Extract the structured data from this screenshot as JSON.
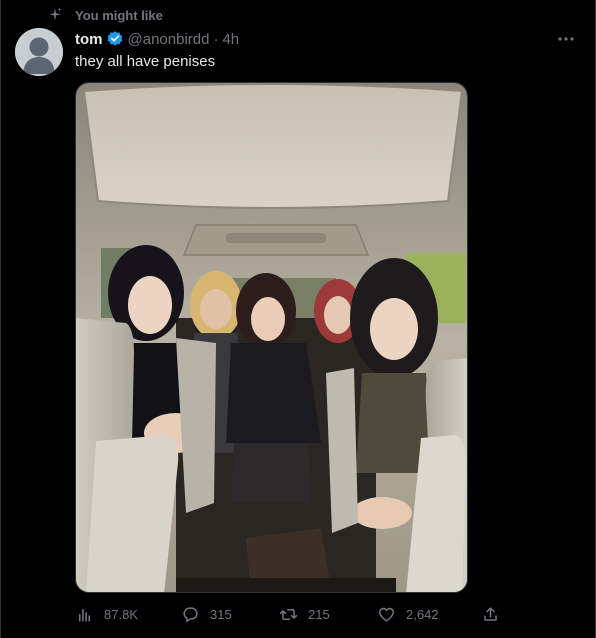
{
  "social_context": {
    "label": "You might like",
    "icon": "sparkle-icon"
  },
  "author": {
    "name": "tom",
    "handle": "@anonbirdd",
    "separator": "·",
    "time": "4h",
    "verified": true,
    "verified_color": "#1d9bf0"
  },
  "tweet": {
    "text": "they all have penises"
  },
  "actions": {
    "views": "87.8K",
    "replies": "315",
    "retweets": "215",
    "likes": "2,642"
  },
  "colors": {
    "background": "#000000",
    "text_primary": "#e7e9ea",
    "text_secondary": "#71767b",
    "accent": "#1d9bf0"
  }
}
